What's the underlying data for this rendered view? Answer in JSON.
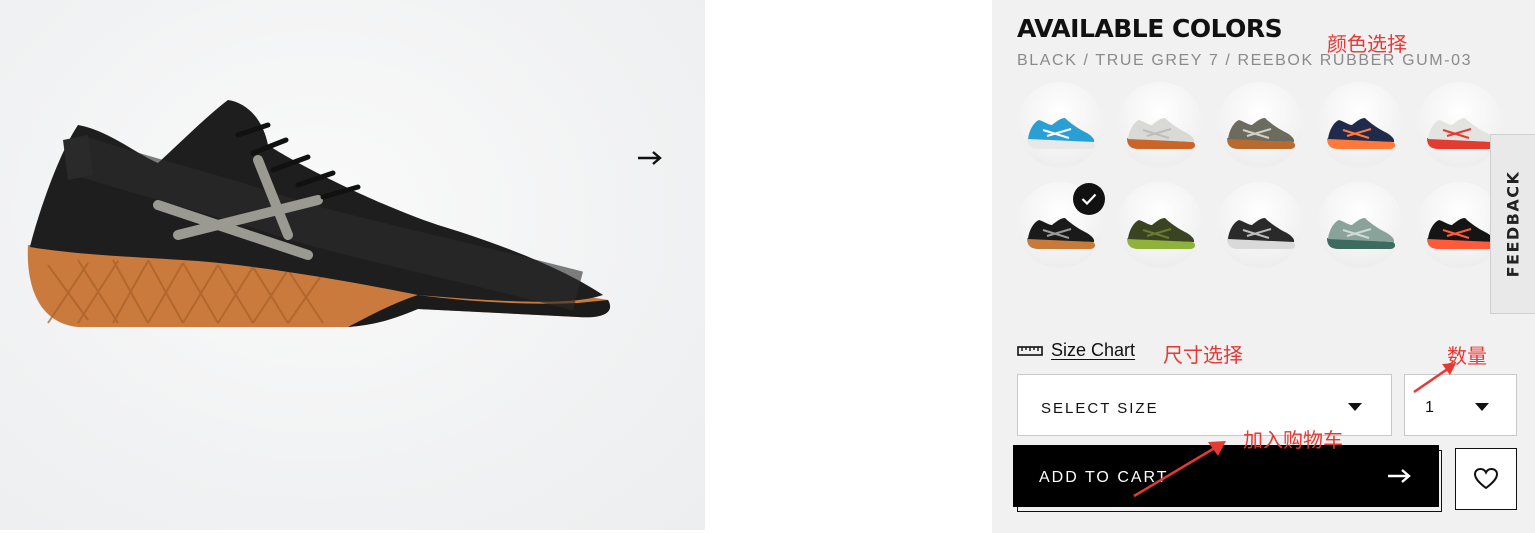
{
  "product": {
    "image_alt": "black training shoe with gum sole"
  },
  "colors": {
    "title": "AVAILABLE COLORS",
    "selected_name": "BLACK / TRUE GREY 7 / REEBOK RUBBER GUM-03",
    "swatches": [
      {
        "upper": "#2a9fd6",
        "sole": "#e8e8e8",
        "accent": "#ffffff",
        "selected": false
      },
      {
        "upper": "#d9d9d6",
        "sole": "#c9652a",
        "accent": "#bdbdbd",
        "selected": false
      },
      {
        "upper": "#6b6b5e",
        "sole": "#b86a2f",
        "accent": "#cfcfcf",
        "selected": false
      },
      {
        "upper": "#1f2a4d",
        "sole": "#ff7a3a",
        "accent": "#ff7a3a",
        "selected": false
      },
      {
        "upper": "#e3e3e0",
        "sole": "#e33b2f",
        "accent": "#e33b2f",
        "selected": false
      },
      {
        "upper": "#1a1a1a",
        "sole": "#c77a3a",
        "accent": "#9a9a9a",
        "selected": true
      },
      {
        "upper": "#3b4422",
        "sole": "#8fb23a",
        "accent": "#6a7a30",
        "selected": false
      },
      {
        "upper": "#2a2a2a",
        "sole": "#d9d9d9",
        "accent": "#bbbbbb",
        "selected": false
      },
      {
        "upper": "#8aa39a",
        "sole": "#3e6b60",
        "accent": "#cfd9d5",
        "selected": false
      },
      {
        "upper": "#151515",
        "sole": "#ff5a3a",
        "accent": "#ff5a3a",
        "selected": false
      }
    ]
  },
  "feedback": {
    "label": "FEEDBACK"
  },
  "size_chart": {
    "label": "Size Chart"
  },
  "size_select": {
    "label": "SELECT SIZE"
  },
  "quantity": {
    "value": "1"
  },
  "cart": {
    "label": "ADD TO CART"
  },
  "annotations": {
    "color_choice": "颜色选择",
    "size_choice": "尺寸选择",
    "quantity": "数量",
    "add_to_cart": "加入购物车",
    "color": "#e53935"
  }
}
